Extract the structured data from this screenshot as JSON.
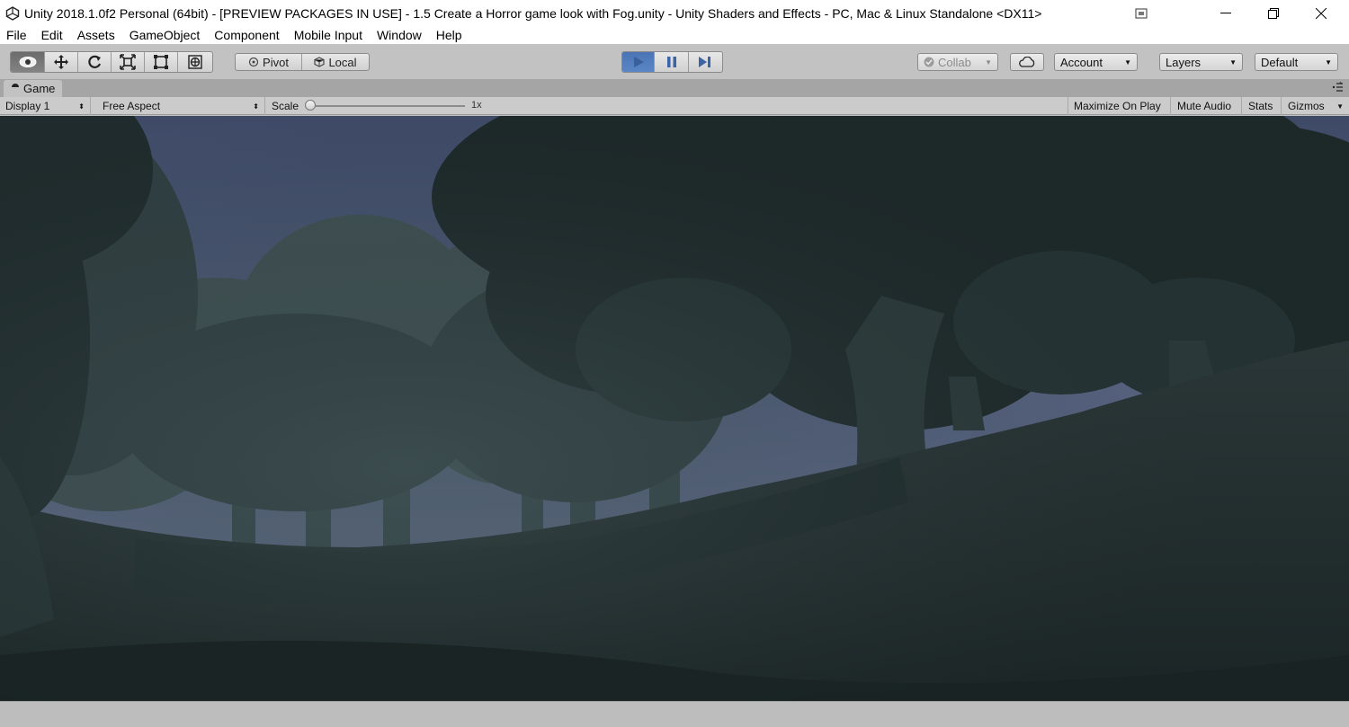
{
  "window": {
    "title": "Unity 2018.1.0f2 Personal (64bit) - [PREVIEW PACKAGES IN USE] - 1.5 Create a Horror game look with Fog.unity - Unity Shaders and Effects - PC, Mac & Linux Standalone <DX11>"
  },
  "menu": {
    "items": [
      "File",
      "Edit",
      "Assets",
      "GameObject",
      "Component",
      "Mobile Input",
      "Window",
      "Help"
    ]
  },
  "toolbar": {
    "tools": [
      "view-tool",
      "move-tool",
      "rotate-tool",
      "scale-tool",
      "rect-tool",
      "transform-tool"
    ],
    "active_tool": "view-tool",
    "pivot_label": "Pivot",
    "local_label": "Local",
    "play_state": "playing",
    "collab_label": "Collab",
    "account_label": "Account",
    "layers_label": "Layers",
    "layout_label": "Default"
  },
  "game_tab": {
    "label": "Game"
  },
  "game_bar": {
    "display": "Display 1",
    "aspect": "Free Aspect",
    "scale_label": "Scale",
    "scale_value": "1x",
    "scale_fraction": 0.0,
    "maximize_on_play": "Maximize On Play",
    "mute_audio": "Mute Audio",
    "stats": "Stats",
    "gizmos": "Gizmos"
  },
  "colors": {
    "editor_bg": "#c2c2c2",
    "play_active": "#4a74b4",
    "sky": "#4c5a78",
    "fog_tint": "#2c3a3b"
  }
}
